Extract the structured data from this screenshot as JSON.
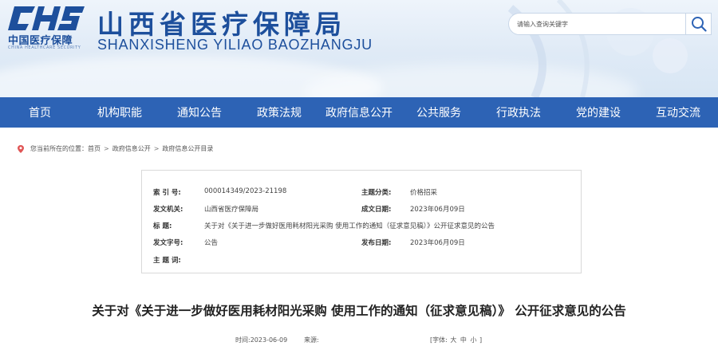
{
  "header": {
    "logo_mark": "CHS",
    "logo_cn": "中国医疗保障",
    "logo_en": "CHINA HEALTHCARE SECURITY",
    "site_title_cn": "山西省医疗保障局",
    "site_title_en": "SHANXISHENG YILIAO BAOZHANGJU",
    "brand_color": "#1d4f9c"
  },
  "search": {
    "placeholder": "请输入查询关键字",
    "button_icon": "search-icon"
  },
  "nav": {
    "bg_color": "#2d63b5",
    "items": [
      "首页",
      "机构职能",
      "通知公告",
      "政策法规",
      "政府信息公开",
      "公共服务",
      "行政执法",
      "党的建设",
      "互动交流"
    ]
  },
  "breadcrumb": {
    "icon": "location-pin-icon",
    "prefix": "您当前所在的位置：",
    "items": [
      "首页",
      "政府信息公开",
      "政府信息公开目录"
    ],
    "separator": ">"
  },
  "info": {
    "index_label": "索  引  号:",
    "index_value": "000014349/2023-21198",
    "category_label": "主题分类:",
    "category_value": "价格招采",
    "issuer_label": "发文机关:",
    "issuer_value": "山西省医疗保障局",
    "created_label": "成文日期:",
    "created_value": "2023年06月09日",
    "title_label": "标      题:",
    "title_value": "关于对《关于进一步做好医用耗材阳光采购 使用工作的通知（征求意见稿）》公开征求意见的公告",
    "docno_label": "发文字号:",
    "docno_value": "公告",
    "published_label": "发布日期:",
    "published_value": "2023年06月09日",
    "keywords_label": "主  题  词:",
    "keywords_value": ""
  },
  "article": {
    "title": "关于对《关于进一步做好医用耗材阳光采购 使用工作的通知（征求意见稿）》 公开征求意见的公告",
    "time_label": "时间:",
    "time_value": "2023-06-09",
    "source_label": "来源:",
    "source_value": "",
    "font_label": "[字体:",
    "font_large": "大",
    "font_medium": "中",
    "font_small": "小",
    "font_close": "]"
  }
}
